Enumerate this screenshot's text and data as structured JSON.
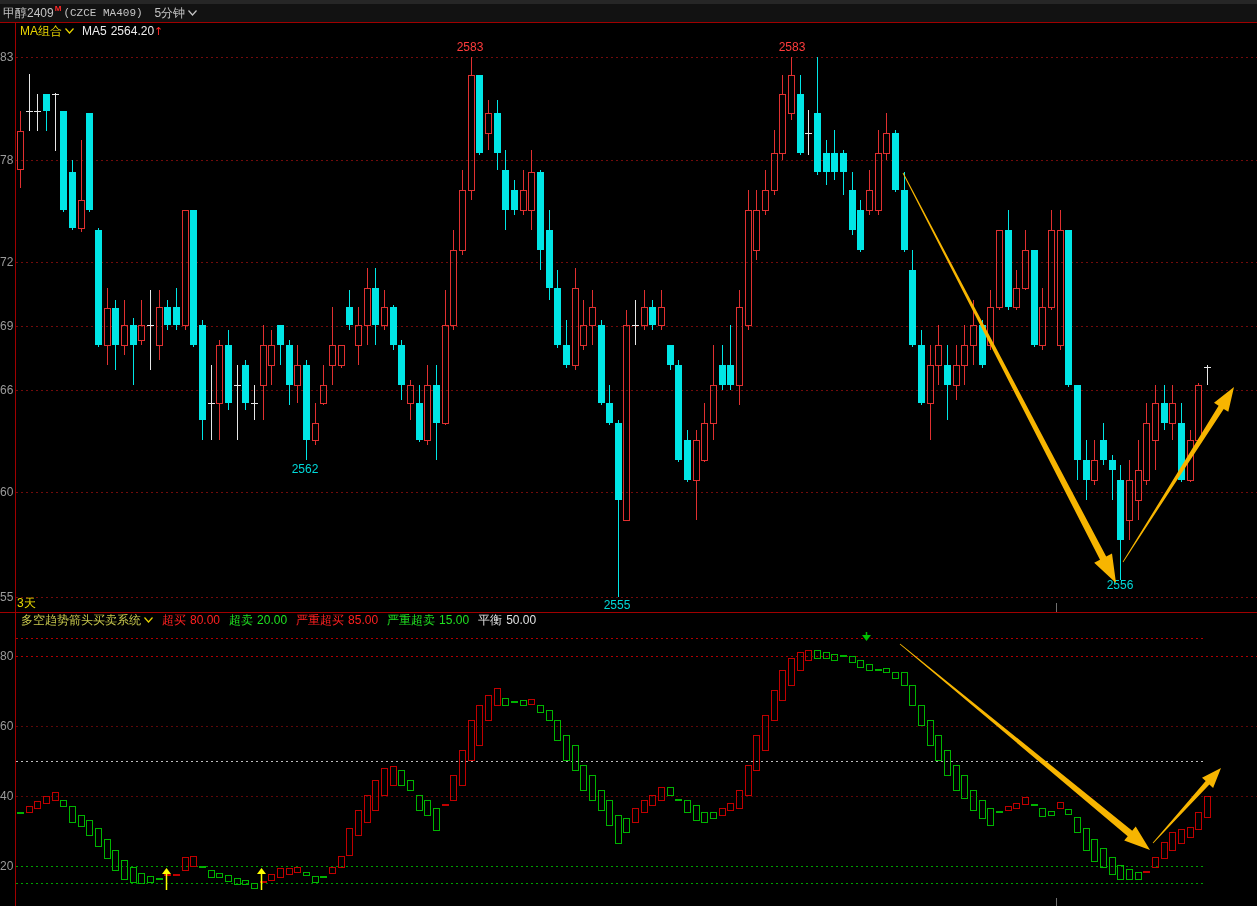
{
  "title_bar": {
    "symbol": "甲醇2409",
    "symbol_mark": "M",
    "exchange_code": "(CZCE MA409)",
    "period": "5分钟"
  },
  "price_panel": {
    "indicator_menu": "MA组合",
    "moving_average": {
      "label": "MA5",
      "value": "2564.20",
      "trend": "↑"
    },
    "y_axis_labels": [
      "83",
      "78",
      "72",
      "69",
      "66",
      "60",
      "55"
    ],
    "extreme_labels": [
      {
        "text": "2583",
        "kind": "high"
      },
      {
        "text": "2583",
        "kind": "high"
      },
      {
        "text": "2562",
        "kind": "low"
      },
      {
        "text": "2556",
        "kind": "low"
      },
      {
        "text": "2555",
        "kind": "low"
      }
    ],
    "range_label": "3天"
  },
  "indicator_panel": {
    "indicator_menu": "多空趋势箭头买卖系统",
    "parameters": [
      {
        "label": "超买",
        "value": "80.00",
        "color": "#ff2020"
      },
      {
        "label": "超卖",
        "value": "20.00",
        "color": "#20e020"
      },
      {
        "label": "严重超买",
        "value": "85.00",
        "color": "#ff2020"
      },
      {
        "label": "严重超卖",
        "value": "15.00",
        "color": "#20e020"
      },
      {
        "label": "平衡",
        "value": "50.00",
        "color": "#e0e0e0"
      }
    ],
    "y_axis_labels": [
      "80",
      "60",
      "40",
      "20"
    ]
  }
}
